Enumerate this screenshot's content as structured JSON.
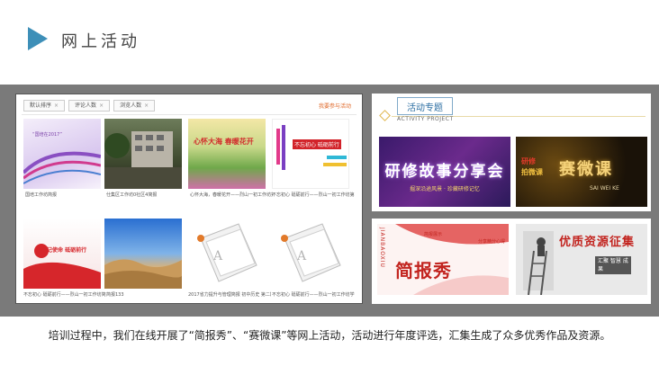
{
  "header": {
    "title": "网上活动"
  },
  "filters": {
    "items": [
      "默认排序",
      "评论人数",
      "浏览人数"
    ],
    "clear_glyph": "×",
    "want_label": "我要参与活动"
  },
  "activities": [
    {
      "caption": "国培工作坊简报"
    },
    {
      "caption": "仕集区工作坊0社区4简报"
    },
    {
      "caption": "心怀大海，春暖花开——烈山一初工作坊第三期"
    },
    {
      "caption": "不忘初心 砥砺前行——烈山一初工作坊第二"
    },
    {
      "caption": "不忘初心 砥砺前行——烈山一初工作坊简报"
    },
    {
      "caption": "简报133"
    },
    {
      "caption": "2017省力提升与管理简报 初中历史 第二期"
    },
    {
      "caption": "不忘初心 砥砺前行——烈山一初工作坊学习"
    }
  ],
  "thumb_text": {
    "t1_title": "“国培在2017”",
    "t2_title": "“国培在2017”",
    "t3_title": "心怀大海 春暖花开",
    "t4_title": "不忘初心 砥砺前行",
    "t5_title": "牢记使命 砥砺前行"
  },
  "topic": {
    "title": "活动专题",
    "subtitle": "ACTIVITY PROJECT"
  },
  "banners": {
    "story_title": "研修故事分享会",
    "story_sub": "掘深沿途风景 · 珍藏研修记忆",
    "micro_title": "赛微课",
    "micro_left1": "研修",
    "micro_left2": "拍微课",
    "micro_sub": "SAI WEI KE",
    "report_title": "简报秀",
    "report_side": "JIANBAOXIU",
    "report_sub": "简报展示",
    "report_right": "分享精分心得",
    "res_title": "优质资源征集",
    "res_sub": "汇聚 智慧 成果"
  },
  "caption": "培训过程中，我们在线开展了“简报秀”、“赛微课”等网上活动，活动进行年度评选，汇集生成了众多优秀作品及资源。",
  "colors": {
    "accent": "#3d8fb8",
    "band": "#7a7a7a",
    "red": "#c2241f"
  }
}
